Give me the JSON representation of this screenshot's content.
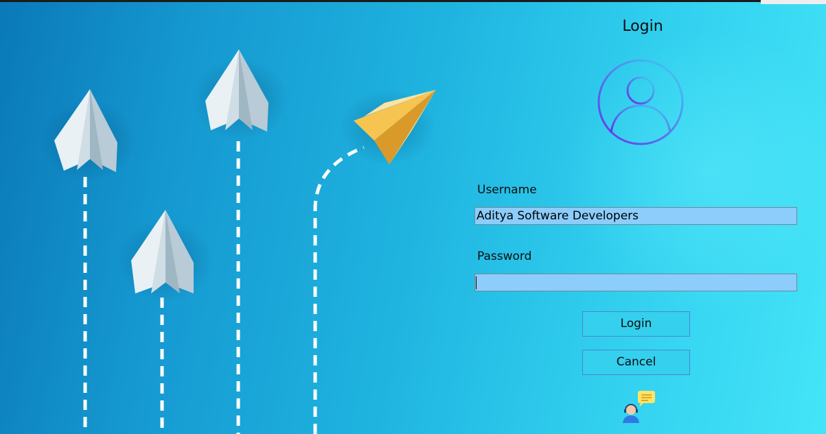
{
  "window": {
    "title": "Login",
    "background_gradient": [
      "#0a79b8",
      "#1fb4e0",
      "#44e4f8"
    ]
  },
  "form": {
    "username_label": "Username",
    "username_value": "Aditya Software Developers",
    "password_label": "Password",
    "password_value": "",
    "field_background": "#8ccdfb"
  },
  "buttons": {
    "login": "Login",
    "cancel": "Cancel",
    "background": "#34d0ee"
  },
  "icons": {
    "avatar": "user-avatar-icon",
    "support": "support-chat-icon"
  },
  "illustration": {
    "plane_colors": {
      "white": "#dde8ee",
      "gold": "#f0b93c"
    }
  }
}
